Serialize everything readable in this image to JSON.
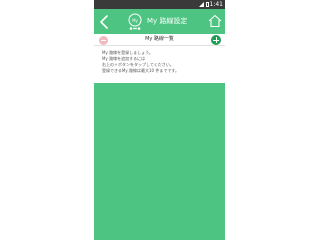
{
  "status_bar": {
    "time": "1:41",
    "icons": [
      "signal-icon",
      "battery-icon"
    ]
  },
  "header": {
    "title": "My 路線設定",
    "back_icon": "back-arrow-icon",
    "home_icon": "home-icon",
    "logo_icon": "app-logo-icon"
  },
  "list_header": {
    "title": "My 路線一覧",
    "remove_icon": "minus-icon",
    "add_icon": "plus-icon"
  },
  "instructions": [
    "My 路線を登録しましょう。",
    "My 路線を追加するには",
    "右上の＋ボタンをタップしてください。",
    "登録できるMy 路線は最大10 件までです。"
  ],
  "colors": {
    "accent": "#4dc481",
    "add_button": "#1d9f57",
    "remove_button": "#f0b8bf",
    "status_bar": "#3a3a3a"
  }
}
